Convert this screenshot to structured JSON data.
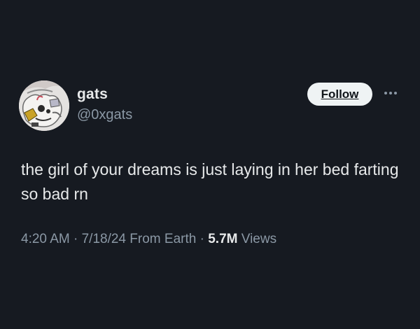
{
  "author": {
    "display_name": "gats",
    "handle": "@0xgats",
    "avatar_icon": "avatar-icon"
  },
  "actions": {
    "follow_label": "Follow",
    "more_icon": "more-icon"
  },
  "tweet": {
    "text": "the girl of your dreams is just laying in her bed farting so bad rn",
    "time": "4:20 AM",
    "date": "7/18/24",
    "location": "From Earth",
    "separator": "·",
    "views_count": "5.7M",
    "views_label": "Views"
  },
  "colors": {
    "background": "#161a21",
    "primary_text": "#e7e9ea",
    "secondary_text": "#8b98a5",
    "follow_button_bg": "#eff3f4"
  }
}
